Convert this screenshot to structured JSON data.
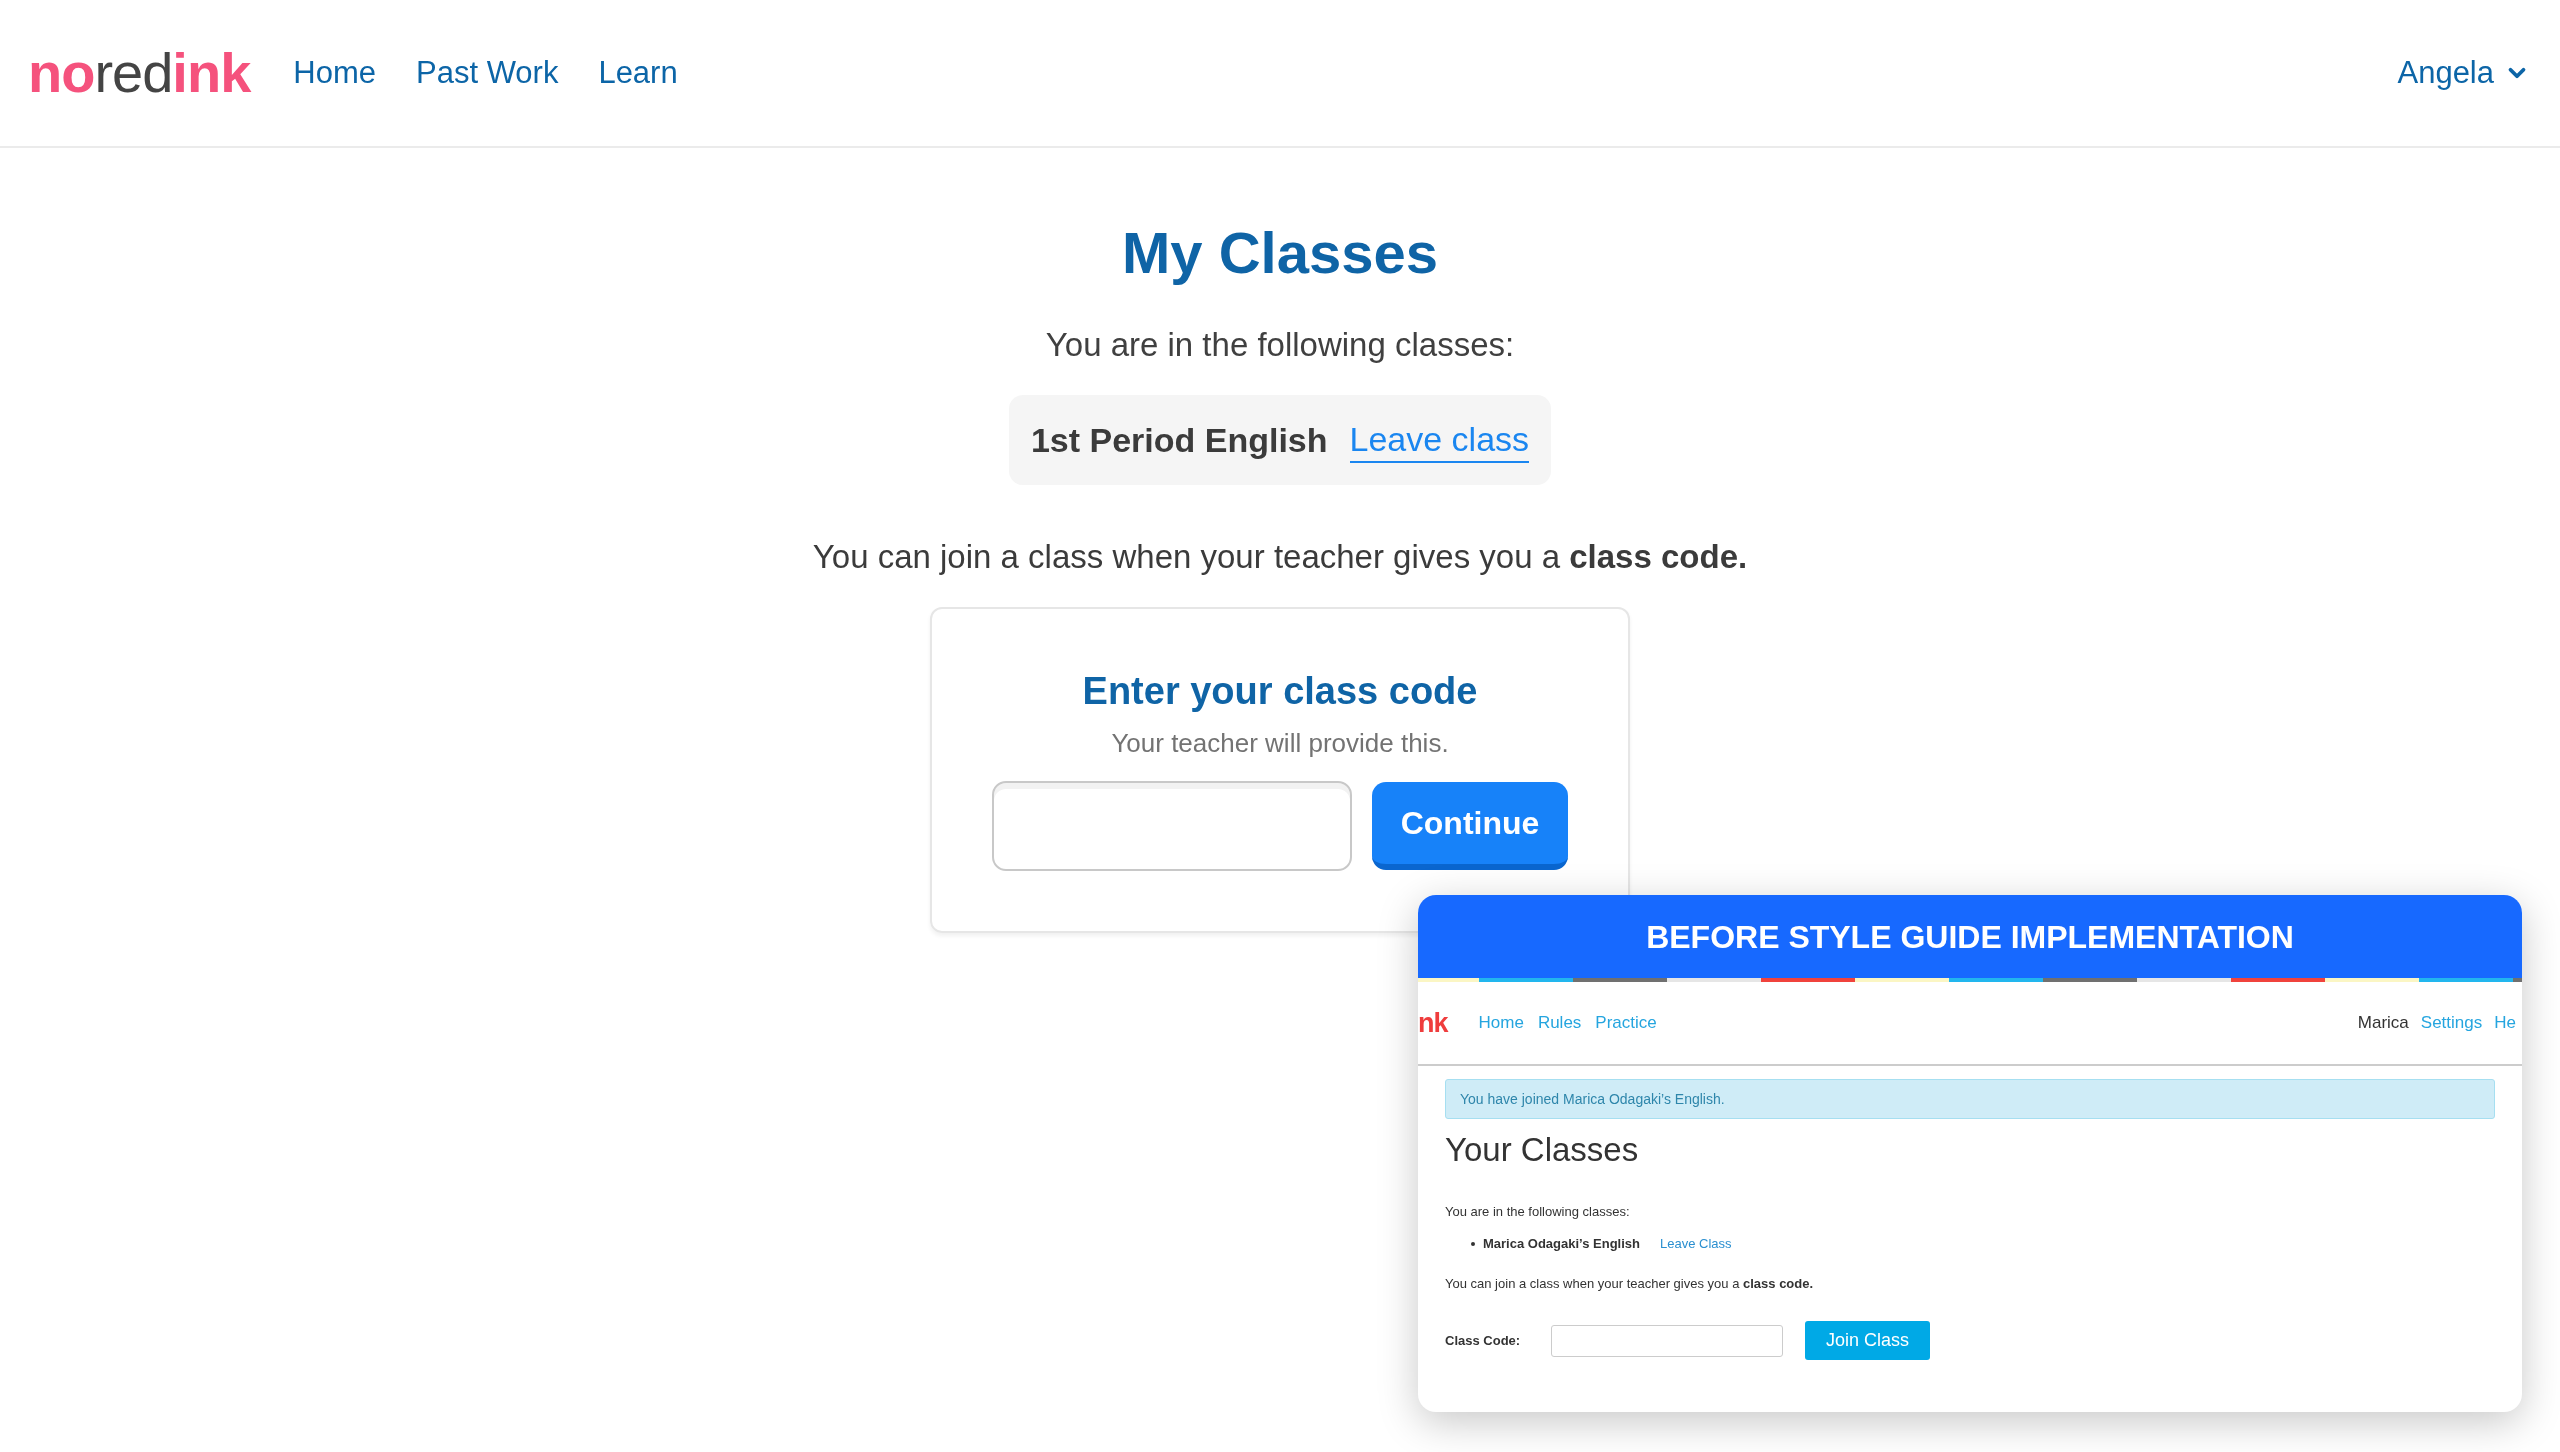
{
  "header": {
    "logo": [
      {
        "text": "no",
        "kind": "accent"
      },
      {
        "text": "red",
        "kind": "plain"
      },
      {
        "text": "ink",
        "kind": "accent"
      }
    ],
    "nav": [
      {
        "label": "Home"
      },
      {
        "label": "Past Work"
      },
      {
        "label": "Learn"
      }
    ],
    "user_menu": {
      "label": "Angela"
    }
  },
  "page": {
    "title": "My Classes",
    "intro": "You are in the following classes:",
    "classes": [
      {
        "name": "1st Period English",
        "action": "Leave class"
      }
    ],
    "join_text": "You can join a class when your teacher gives you a **class code.**",
    "code_card": {
      "title": "Enter your class code",
      "subtitle": "Your teacher will provide this.",
      "button": "Continue"
    }
  },
  "comparison_overlay": {
    "banner": "BEFORE STYLE GUIDE IMPLEMENTATION",
    "old_page": {
      "logo_fragment": "nk",
      "nav": [
        "Home",
        "Rules",
        "Practice"
      ],
      "user": "Marica",
      "links": [
        "Settings",
        "He"
      ],
      "alert": "You have joined Marica Odagaki’s English.",
      "title": "Your Classes",
      "intro": "You are in the following classes:",
      "classes": [
        {
          "name": "Marica Odagaki’s English",
          "action": "Leave Class"
        }
      ],
      "join_text": "You can join a class when your teacher gives you a **class code.**",
      "code_label": "Class Code:",
      "button": "Join Class"
    }
  }
}
